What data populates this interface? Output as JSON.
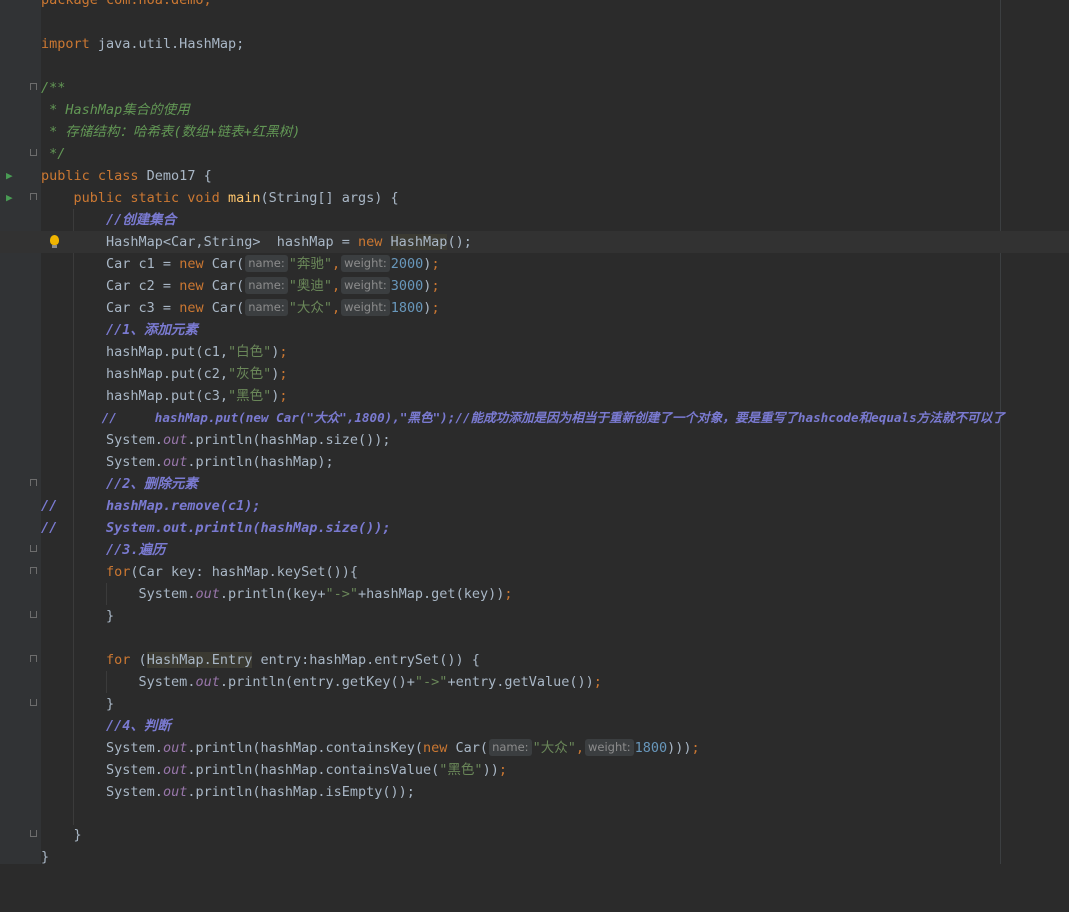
{
  "code": {
    "package_line": "package com.hoa.demo;",
    "import_kw": "import",
    "import_path": " java.util.HashMap;",
    "doc_open": "/**",
    "doc_line1": " * HashMap集合的使用",
    "doc_line2": " * 存储结构：哈希表(数组+链表+红黑树)",
    "doc_close": " */",
    "class_kw": "public class",
    "class_name": " Demo17 {",
    "main_mods": "public static void",
    "main_name": "main",
    "main_params": "(String[] args) {",
    "c_create": "//创建集合",
    "decl_left": "HashMap<Car,String>  hashMap = ",
    "kw_new": "new",
    "decl_type": "HashMap",
    "decl_end": "();",
    "car_c1": "Car c1 = ",
    "car_c2": "Car c2 = ",
    "car_c3": "Car c3 = ",
    "car_ctor": " Car(",
    "hint_name": "name:",
    "hint_weight": "weight:",
    "s_benchi": "\"奔驰\"",
    "s_aodi": "\"奥迪\"",
    "s_dazhong": "\"大众\"",
    "n_2000": "2000",
    "n_3000": "3000",
    "n_1800": "1800",
    "close_paren": ")",
    "comma": ",",
    "semi": ";",
    "c_add": "//1、添加元素",
    "put_c1": "hashMap.put(c1,",
    "put_c2": "hashMap.put(c2,",
    "put_c3": "hashMap.put(c3,",
    "s_white": "\"白色\"",
    "s_gray": "\"灰色\"",
    "s_black": "\"黑色\"",
    "c_put_new": "//     hashMap.put(new Car(\"大众\",1800),\"黑色\");//能成功添加是因为相当于重新创建了一个对象，要是重写了hashcode和equals方法就不可以了",
    "sys": "System.",
    "out": "out",
    "println_size": ".println(hashMap.size());",
    "println_map": ".println(hashMap);",
    "c_remove": "//2、删除元素",
    "cm_remove": "//      hashMap.remove(c1);",
    "cm_size": "//      System.out.println(hashMap.size());",
    "c_iter": "//3.遍历",
    "kw_for": "for",
    "for1_rest": "(Car key: hashMap.keySet()){",
    "println_key": ".println(key+",
    "s_arrow": "\"->\"",
    "get_key": "+hashMap.get(key))",
    "brace_close": "}",
    "for2_open": " (",
    "entry_type": "HashMap.Entry",
    "for2_rest": " entry:hashMap.entrySet()) {",
    "println_entry": ".println(entry.getKey()+",
    "entry_value": "+entry.getValue())",
    "c_judge": "//4、判断",
    "println_ck": ".println(hashMap.containsKey(",
    "ck_end": ")))",
    "println_cv": ".println(hashMap.containsValue(",
    "cv_end": "))",
    "println_empty": ".println(hashMap.isEmpty());",
    "icons": [
      "run-icon",
      "fold-icon",
      "lightbulb-icon"
    ]
  }
}
